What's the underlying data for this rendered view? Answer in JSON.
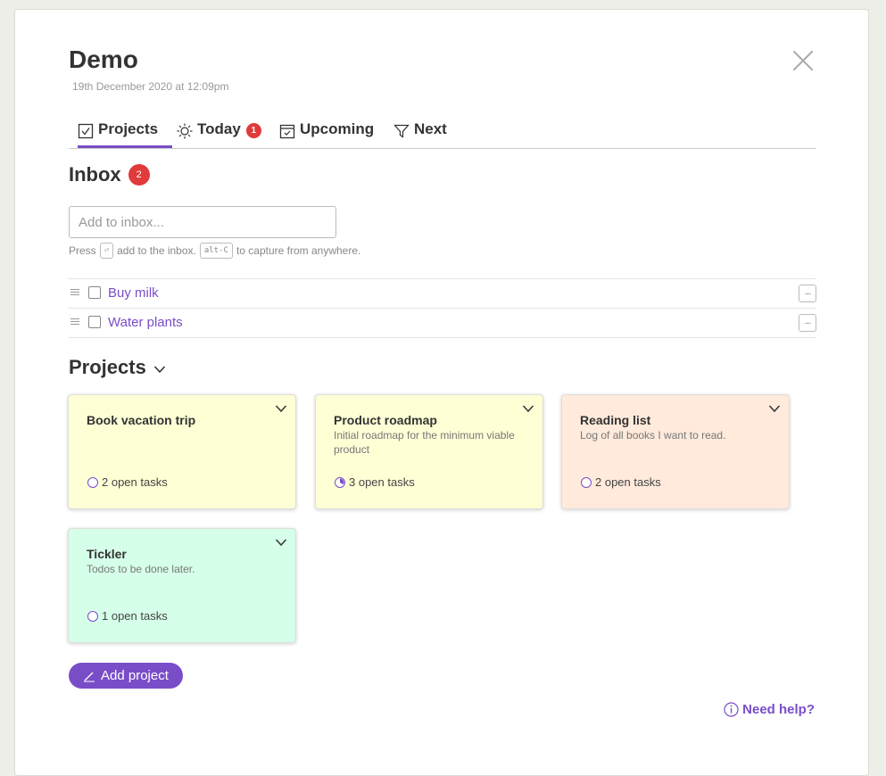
{
  "page": {
    "title": "Demo",
    "timestamp": "19th December 2020 at 12:09pm"
  },
  "tabs": [
    {
      "label": "Projects",
      "icon": "checkbox-icon",
      "active": true
    },
    {
      "label": "Today",
      "icon": "sun-icon",
      "badge": "1"
    },
    {
      "label": "Upcoming",
      "icon": "calendar-icon"
    },
    {
      "label": "Next",
      "icon": "filter-icon"
    }
  ],
  "inbox": {
    "heading": "Inbox",
    "count": "2",
    "placeholder": "Add to inbox...",
    "hint_press": "Press",
    "hint_enter_key": "⏎",
    "hint_mid": "add to the inbox.",
    "hint_capture_key": "alt-C",
    "hint_end": "to capture from anywhere.",
    "items": [
      {
        "title": "Buy milk",
        "more_label": "···"
      },
      {
        "title": "Water plants",
        "more_label": "···"
      }
    ]
  },
  "projects": {
    "heading": "Projects",
    "items": [
      {
        "title": "Book vacation trip",
        "description": "",
        "tasks": "2 open tasks",
        "color": "#ffffd6",
        "progress": 0
      },
      {
        "title": "Product roadmap",
        "description": "Initial roadmap for the minimum viable product",
        "tasks": "3 open tasks",
        "color": "#ffffd6",
        "progress": 0.33
      },
      {
        "title": "Reading list",
        "description": "Log of all books I want to read.",
        "tasks": "2 open tasks",
        "color": "#ffeadb",
        "progress": 0
      },
      {
        "title": "Tickler",
        "description": "Todos to be done later.",
        "tasks": "1 open tasks",
        "color": "#d6ffea",
        "progress": 0
      }
    ]
  },
  "add_project_label": "Add project",
  "help_label": "Need help?",
  "colors": {
    "accent": "#7a4dc8",
    "badge": "#e03a3a"
  }
}
